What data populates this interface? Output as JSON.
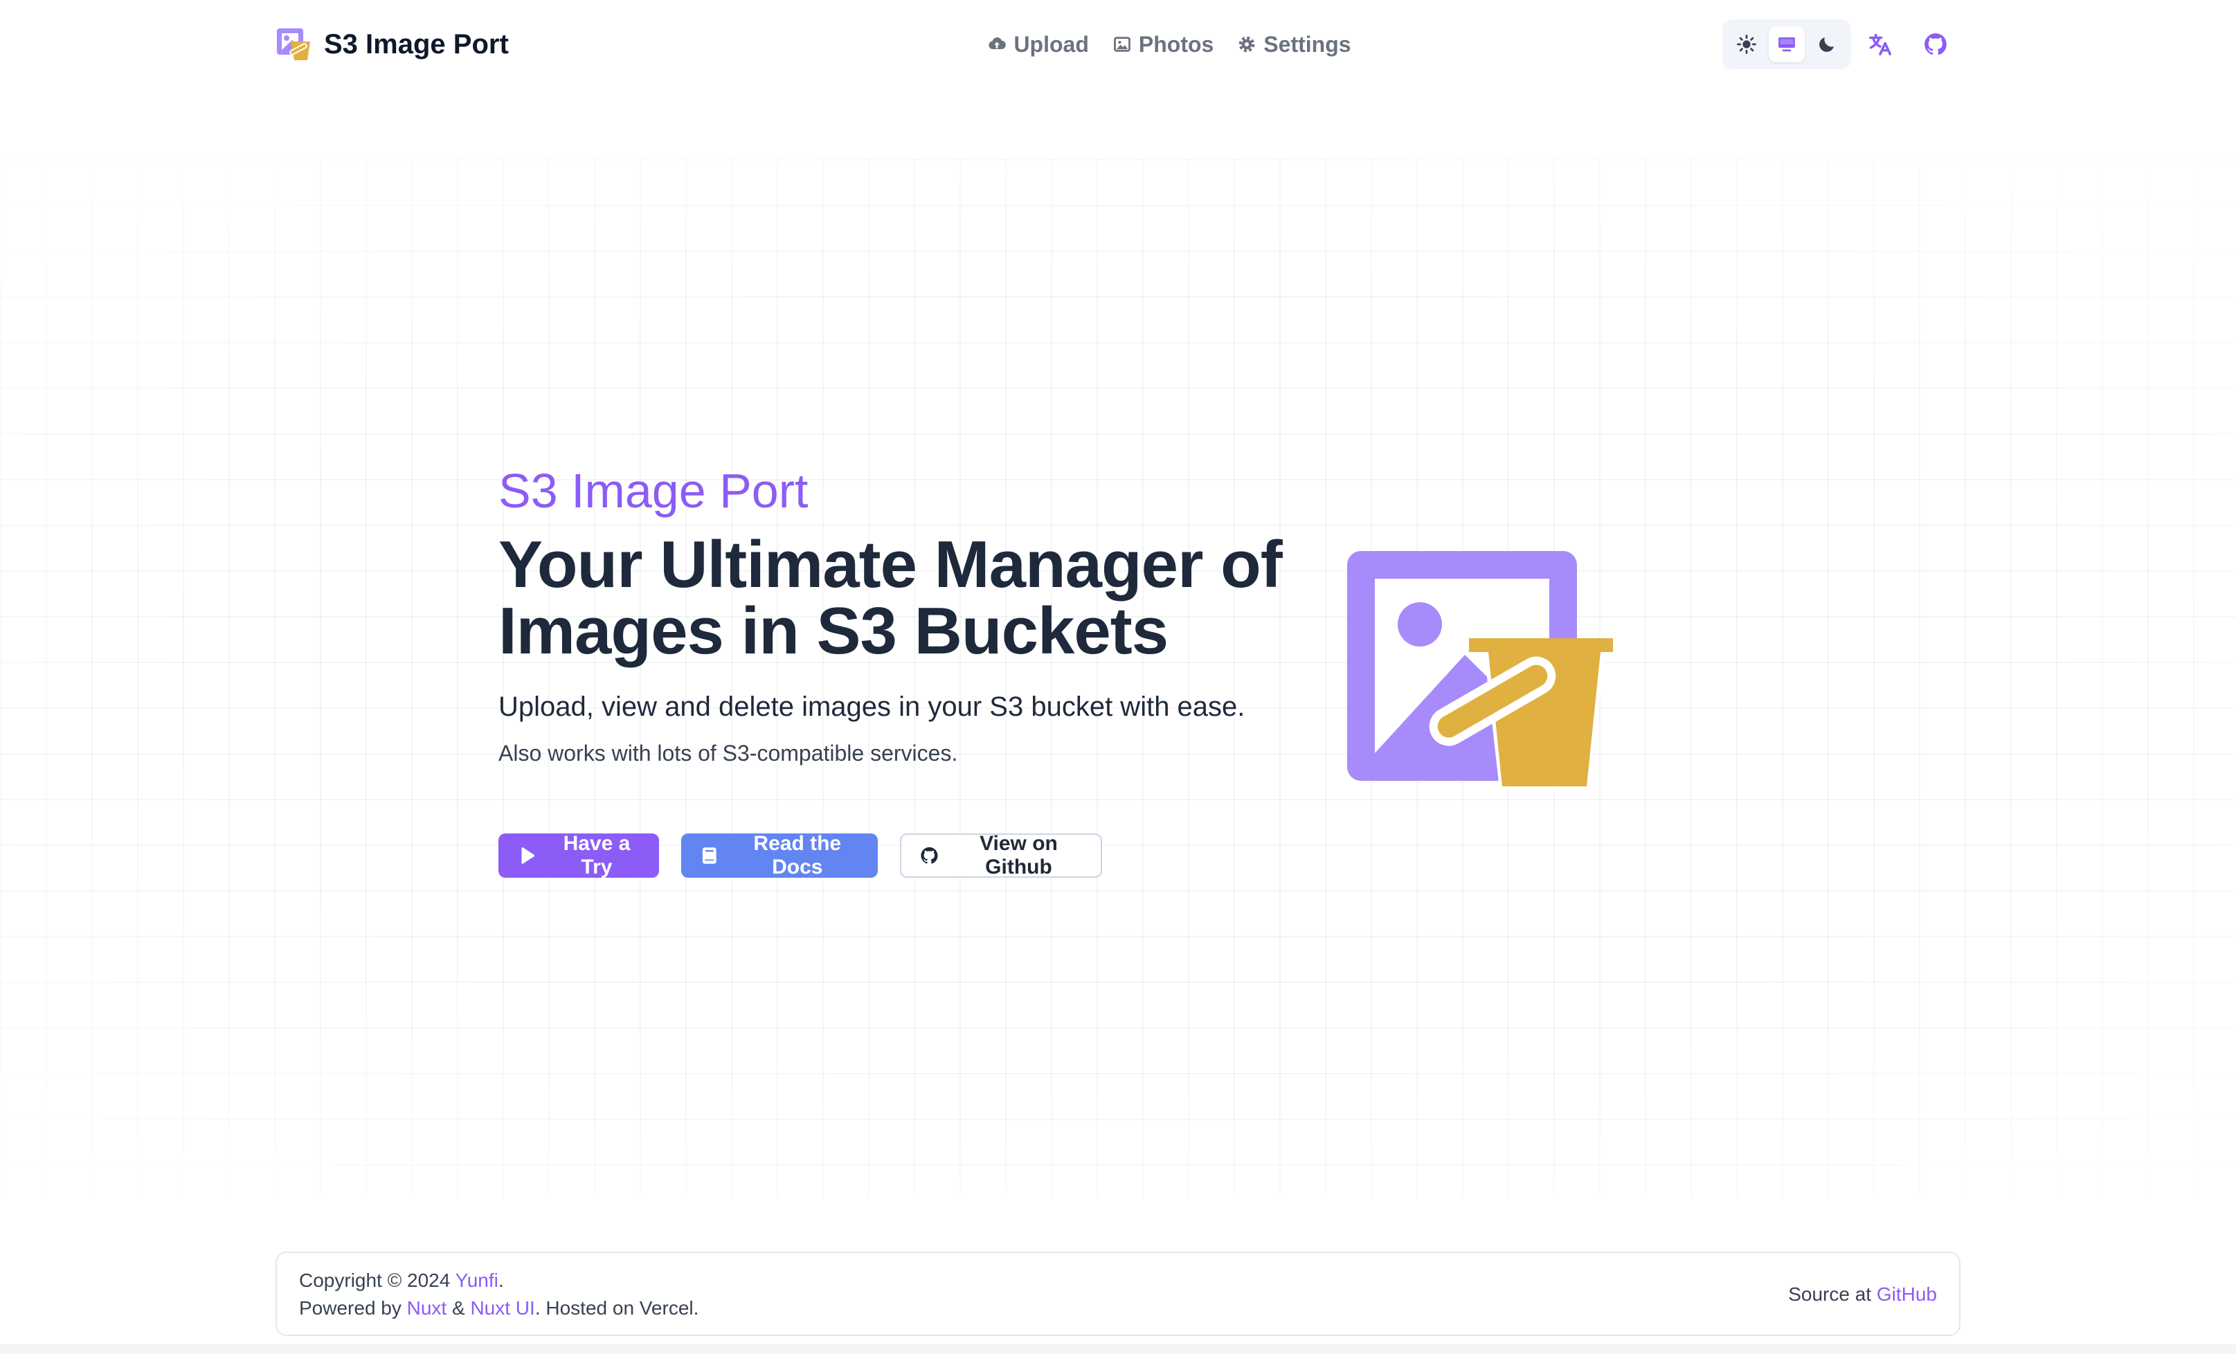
{
  "app": {
    "name": "S3 Image Port"
  },
  "nav": {
    "upload": "Upload",
    "photos": "Photos",
    "settings": "Settings"
  },
  "theme": {
    "options": [
      "light",
      "system",
      "dark"
    ],
    "selected": "system"
  },
  "icons": {
    "brand": "image-bucket-logo",
    "upload": "cloud-upload-icon",
    "photos": "photo-icon",
    "settings": "gear-icon",
    "light": "sun-icon",
    "system": "monitor-icon",
    "dark": "moon-icon",
    "language": "translate-icon",
    "github": "github-icon"
  },
  "hero": {
    "eyebrow": "S3 Image Port",
    "title_line1": "Your Ultimate Manager of",
    "title_line2": "Images in S3 Buckets",
    "subtitle": "Upload, view and delete images in your S3 bucket with ease.",
    "note": "Also works with lots of S3-compatible services."
  },
  "cta": {
    "try": "Have a Try",
    "docs": "Read the Docs",
    "github": "View on Github"
  },
  "footer": {
    "copyright_prefix": "Copyright © 2024 ",
    "author": "Yunfi",
    "period": ".",
    "powered_prefix": "Powered by ",
    "nuxt": "Nuxt",
    "amp": " & ",
    "nuxt_ui": "Nuxt UI",
    "hosted": ". Hosted on Vercel.",
    "source_prefix": "Source at ",
    "source_link": "GitHub"
  },
  "colors": {
    "accent": "#8b5cf6",
    "accent_light": "#a78bfa",
    "docs_button": "#6385f1",
    "bucket": "#e0b040",
    "text_dark": "#1e293b"
  }
}
